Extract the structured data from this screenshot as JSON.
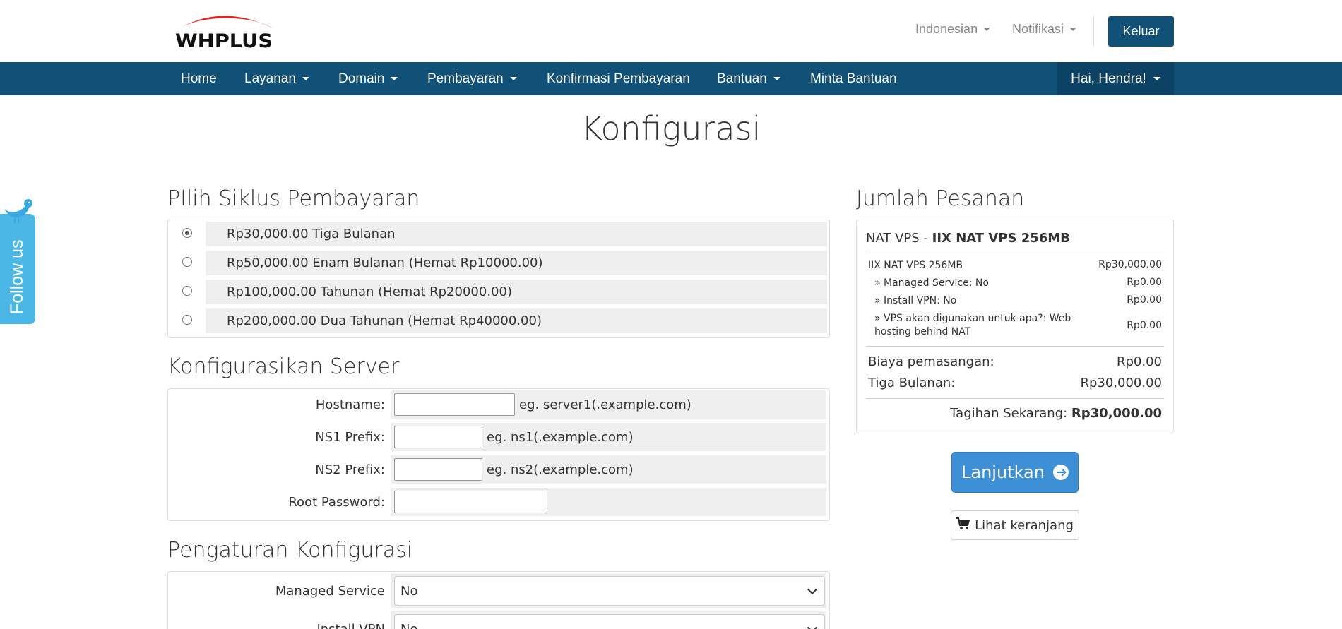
{
  "brand": {
    "logo_text": "WHPLUS",
    "accent_color": "#e8211c",
    "primary_color": "#115077"
  },
  "header": {
    "language_label": "Indonesian",
    "notifications_label": "Notifikasi",
    "logout_label": "Keluar"
  },
  "nav": {
    "items": [
      {
        "label": "Home",
        "dropdown": false
      },
      {
        "label": "Layanan",
        "dropdown": true
      },
      {
        "label": "Domain",
        "dropdown": true
      },
      {
        "label": "Pembayaran",
        "dropdown": true
      },
      {
        "label": "Konfirmasi Pembayaran",
        "dropdown": false
      },
      {
        "label": "Bantuan",
        "dropdown": true
      },
      {
        "label": "Minta Bantuan",
        "dropdown": false
      }
    ],
    "user_label": "Hai, Hendra!"
  },
  "follow": {
    "label": "Follow us",
    "icon": "twitter-bird-icon"
  },
  "page": {
    "title": "Konfigurasi"
  },
  "billing": {
    "heading": "PIlih Siklus Pembayaran",
    "options": [
      {
        "label": "Rp30,000.00 Tiga Bulanan",
        "checked": true
      },
      {
        "label": "Rp50,000.00 Enam Bulanan (Hemat Rp10000.00)",
        "checked": false
      },
      {
        "label": "Rp100,000.00 Tahunan (Hemat Rp20000.00)",
        "checked": false
      },
      {
        "label": "Rp200,000.00 Dua Tahunan (Hemat Rp40000.00)",
        "checked": false
      }
    ]
  },
  "server": {
    "heading": "Konfigurasikan Server",
    "fields": [
      {
        "label": "Hostname:",
        "value": "",
        "hint": "eg. server1(.example.com)"
      },
      {
        "label": "NS1 Prefix:",
        "value": "",
        "hint": "eg. ns1(.example.com)"
      },
      {
        "label": "NS2 Prefix:",
        "value": "",
        "hint": "eg. ns2(.example.com)"
      },
      {
        "label": "Root Password:",
        "value": "",
        "hint": ""
      }
    ]
  },
  "config": {
    "heading": "Pengaturan Konfigurasi",
    "options": [
      {
        "label": "Managed Service",
        "value": "No"
      },
      {
        "label": "Install VPN",
        "value": "No"
      }
    ]
  },
  "summary": {
    "heading": "Jumlah Pesanan",
    "product_group": "NAT VPS",
    "product_name": "IIX NAT VPS 256MB",
    "lines": [
      {
        "label": "IIX NAT VPS 256MB",
        "price": "Rp30,000.00"
      },
      {
        "label": "» Managed Service: No",
        "price": "Rp0.00"
      },
      {
        "label": "» Install VPN: No",
        "price": "Rp0.00"
      },
      {
        "label": "» VPS akan digunakan untuk apa?: Web hosting behind NAT",
        "price": "Rp0.00"
      }
    ],
    "setup_fee_label": "Biaya pemasangan:",
    "setup_fee_value": "Rp0.00",
    "cycle_label": "Tiga Bulanan:",
    "cycle_value": "Rp30,000.00",
    "total_label": "Tagihan Sekarang:",
    "total_value": "Rp30,000.00",
    "continue_label": "Lanjutkan",
    "cart_label": "Lihat keranjang"
  }
}
